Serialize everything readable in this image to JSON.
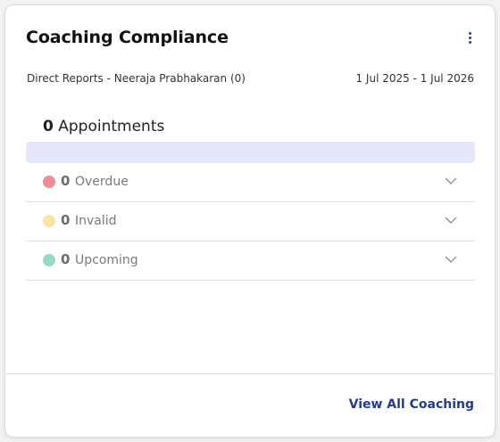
{
  "card": {
    "title": "Coaching Compliance",
    "subtitle": "Direct Reports - Neeraja Prabhakaran (0)",
    "date_range": "1 Jul 2025 - 1 Jul 2026",
    "more_icon": "vertical-dots-icon"
  },
  "appointments": {
    "count": "0",
    "label": "Appointments"
  },
  "status_rows": [
    {
      "count": "0",
      "label": "Overdue",
      "color": "#ee8c98",
      "icon": "chevron-down-icon"
    },
    {
      "count": "0",
      "label": "Invalid",
      "color": "#fbe3a4",
      "icon": "chevron-down-icon"
    },
    {
      "count": "0",
      "label": "Upcoming",
      "color": "#98d9c4",
      "icon": "chevron-down-icon"
    }
  ],
  "footer": {
    "view_all_label": "View All Coaching"
  },
  "colors": {
    "accent": "#233b8f",
    "bar": "#e4e6fa"
  }
}
